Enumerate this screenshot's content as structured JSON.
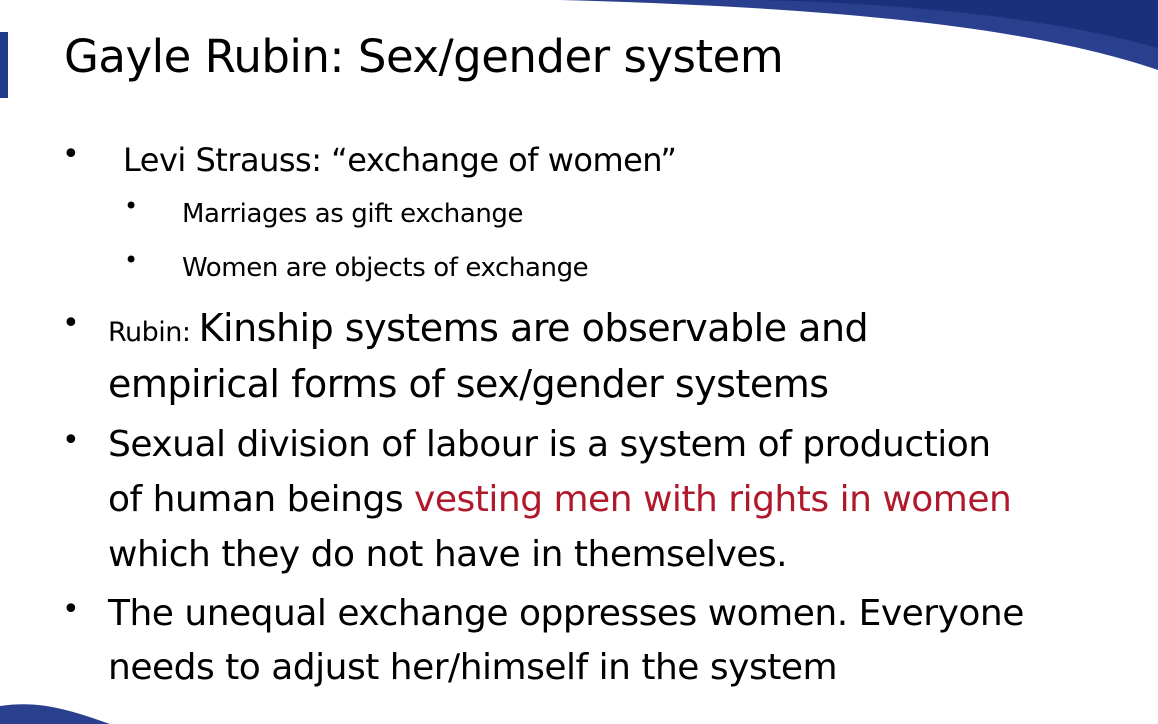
{
  "slide": {
    "title": "Gayle Rubin: Sex/gender system",
    "bullets": [
      {
        "text": "Levi Strauss: “exchange of women”",
        "sub": [
          "Marriages as gift exchange",
          "Women are objects of exchange"
        ]
      },
      {
        "lead": "Rubin: ",
        "line1": "Kinship systems are observable and",
        "line2": "empirical forms of sex/gender systems"
      },
      {
        "line1": "Sexual division of labour is a system of production",
        "line2_a": "of human beings ",
        "line2_highlight": "vesting men with rights in women",
        "line3": "which they do not have in themselves."
      },
      {
        "line1": "The unequal exchange oppresses women. Everyone",
        "line2": "needs to adjust her/himself in the system"
      }
    ],
    "colors": {
      "accent": "#1f3a8a",
      "highlight": "#b0182b"
    }
  }
}
